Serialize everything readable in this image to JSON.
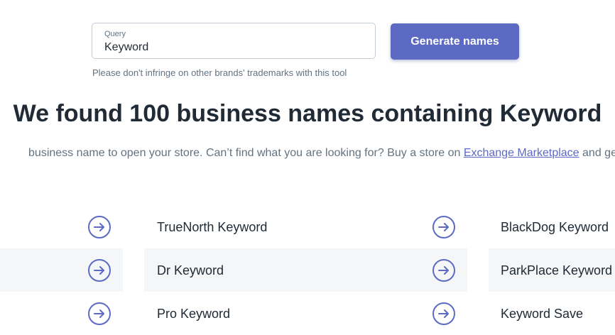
{
  "form": {
    "query_label": "Query",
    "query_value": "Keyword",
    "generate_label": "Generate names",
    "disclaimer": "Please don't infringe on other brands' trademarks with this tool"
  },
  "results": {
    "headline": "We found 100 business names containing Keyword",
    "subtitle_prefix": "business name to open your store. Can’t find what you are looking for? Buy a store on ",
    "subtitle_link": "Exchange Marketplace",
    "subtitle_suffix": " and get a he",
    "names": [
      "TrueNorth Keyword",
      "BlackDog Keyword",
      "Dr Keyword",
      "ParkPlace Keyword",
      "Pro Keyword",
      "Keyword Save"
    ]
  },
  "colors": {
    "accent": "#5c6ac4",
    "row_highlight": "#f4f6f8",
    "muted_text": "#637381"
  },
  "icons": {
    "arrow": "arrow-right-circle-icon"
  }
}
